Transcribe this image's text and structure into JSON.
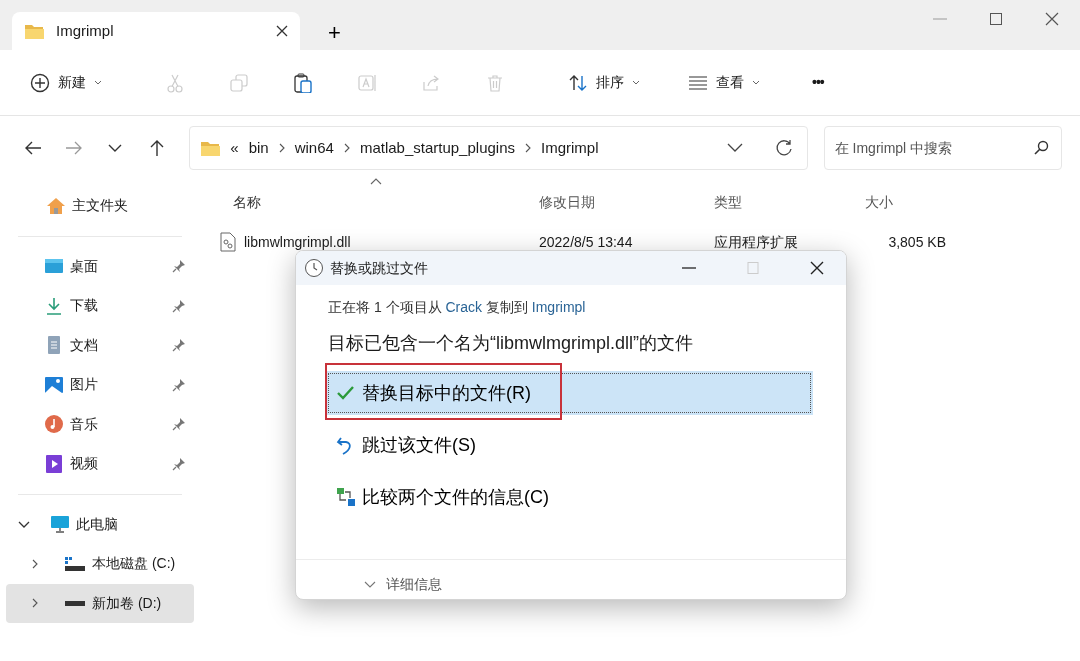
{
  "window": {
    "tab_title": "Imgrimpl",
    "new_tab": "+"
  },
  "toolbar": {
    "items": [
      {
        "kind": "menu",
        "label": "新建"
      },
      {
        "kind": "icon",
        "disabled": true
      },
      {
        "kind": "icon",
        "disabled": true
      },
      {
        "kind": "icon",
        "disabled": false
      },
      {
        "kind": "icon",
        "disabled": true
      },
      {
        "kind": "icon",
        "disabled": true
      },
      {
        "kind": "icon",
        "disabled": true
      },
      {
        "kind": "menu",
        "label": "排序"
      },
      {
        "kind": "menu",
        "label": "查看"
      },
      {
        "kind": "more",
        "label": "•••"
      }
    ]
  },
  "address": {
    "overflow": "«",
    "segments": [
      "bin",
      "win64",
      "matlab_startup_plugins",
      "Imgrimpl"
    ]
  },
  "search": {
    "placeholder": "在 Imgrimpl 中搜索"
  },
  "sidebar": {
    "home": {
      "label": "主文件夹"
    },
    "quick_access": [
      {
        "label": "桌面",
        "pinned": true
      },
      {
        "label": "下载",
        "pinned": true
      },
      {
        "label": "文档",
        "pinned": true
      },
      {
        "label": "图片",
        "pinned": true
      },
      {
        "label": "音乐",
        "pinned": true
      },
      {
        "label": "视频",
        "pinned": true
      }
    ],
    "this_pc": {
      "label": "此电脑",
      "expanded": true,
      "children": [
        {
          "label": "本地磁盘 (C:)",
          "selected": false,
          "expanded": false
        },
        {
          "label": "新加卷 (D:)",
          "selected": true,
          "expanded": false
        }
      ]
    }
  },
  "table": {
    "columns": [
      {
        "label": "名称",
        "sorted": true
      },
      {
        "label": "修改日期",
        "sorted": false
      },
      {
        "label": "类型",
        "sorted": false
      },
      {
        "label": "大小",
        "sorted": false
      }
    ],
    "rows": [
      {
        "name": "libmwlmgrimpl.dll",
        "modified": "2022/8/5 13:44",
        "type": "应用程序扩展",
        "size": "3,805 KB"
      }
    ]
  },
  "dialog": {
    "title": "替换或跳过文件",
    "copy_line": {
      "prefix": "正在将 1 个项目从",
      "source": "Crack",
      "middle": "复制到",
      "destination": "Imgrimpl"
    },
    "heading": "目标已包含一个名为“libmwlmgrimpl.dll”的文件",
    "options": [
      {
        "kind": "replace",
        "label": "替换目标中的文件(R)",
        "selected": true,
        "annotated": true
      },
      {
        "kind": "skip",
        "label": "跳过该文件(S)",
        "selected": false,
        "annotated": false
      },
      {
        "kind": "compare",
        "label": "比较两个文件的信息(C)",
        "selected": false,
        "annotated": false
      }
    ],
    "details": {
      "label": "详细信息",
      "expanded": false
    }
  }
}
